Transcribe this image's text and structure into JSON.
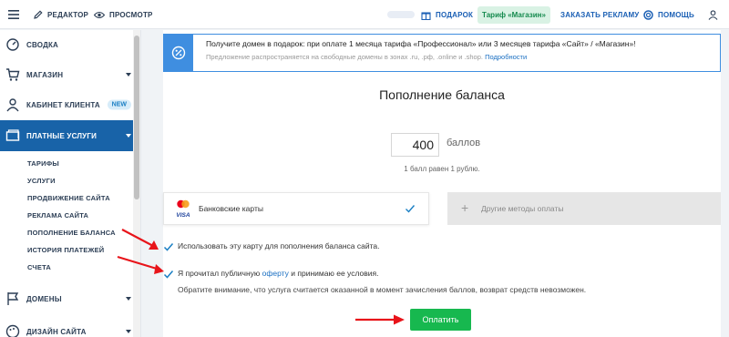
{
  "topbar": {
    "editor_label": "РЕДАКТОР",
    "preview_label": "ПРОСМОТР",
    "gift_label": "ПОДАРОК",
    "tariff_label": "Тариф «Магазин»",
    "ads_label": "ЗАКАЗАТЬ РЕКЛАМУ",
    "help_label": "ПОМОЩЬ"
  },
  "sidebar": {
    "items": [
      {
        "label": "СВОДКА",
        "icon": "dashboard-icon"
      },
      {
        "label": "МАГАЗИН",
        "icon": "cart-icon"
      },
      {
        "label": "КАБИНЕТ КЛИЕНТА",
        "icon": "user-icon",
        "badge": "NEW"
      },
      {
        "label": "ПЛАТНЫЕ УСЛУГИ",
        "icon": "money-icon"
      },
      {
        "label": "ДОМЕНЫ",
        "icon": "flag-icon"
      },
      {
        "label": "ДИЗАЙН САЙТА",
        "icon": "palette-icon"
      }
    ],
    "subitems": [
      {
        "label": "ТАРИФЫ"
      },
      {
        "label": "УСЛУГИ"
      },
      {
        "label": "ПРОДВИЖЕНИЕ САЙТА"
      },
      {
        "label": "РЕКЛАМА САЙТА"
      },
      {
        "label": "ПОПОЛНЕНИЕ БАЛАНСА"
      },
      {
        "label": "ИСТОРИЯ ПЛАТЕЖЕЙ"
      },
      {
        "label": "СЧЕТА"
      }
    ]
  },
  "promo": {
    "line1": "Получите домен в подарок: при оплате 1 месяца тарифа «Профессионал» или 3 месяцев тарифа «Сайт» / «Магазин»!",
    "line2": "Предложение распространяется на свободные домены в зонах .ru, .рф, .online и .shop.",
    "link": "Подробности"
  },
  "main": {
    "title": "Пополнение баланса",
    "amount": "400",
    "amount_unit": "баллов",
    "rate": "1 балл равен 1 рублю.",
    "card_label": "Банковские карты",
    "visa_label": "VISA",
    "other_label": "Другие методы оплаты",
    "save_card": "Использовать эту карту для пополнения баланса сайта.",
    "agree_prefix": "Я прочитал публичную",
    "agree_link": "оферту",
    "agree_suffix": "и принимаю ее условия.",
    "note": "Обратите внимание, что услуга считается оказанной в момент зачисления баллов, возврат средств невозможен.",
    "pay_button": "Оплатить"
  },
  "colors": {
    "accent": "#1863a8",
    "pay_button": "#17b84f",
    "link": "#1a6fc2",
    "arrow": "#e8141a",
    "tariff_bg": "#d9f2e4",
    "promo_border": "#3f8ee0"
  }
}
